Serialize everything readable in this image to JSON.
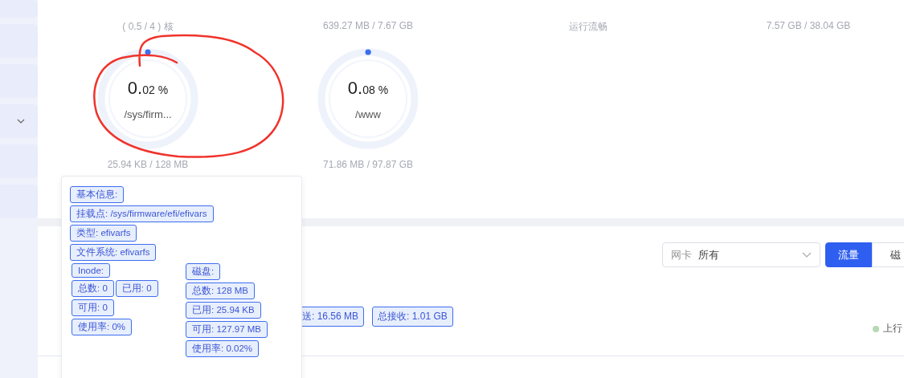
{
  "sidebar": {
    "items": [
      {
        "chevron": false
      },
      {
        "chevron": false
      },
      {
        "chevron": false
      },
      {
        "chevron": true
      },
      {
        "chevron": false
      },
      {
        "chevron": false
      }
    ]
  },
  "top_gauges": [
    {
      "label": "( 0.5 / 4 ) 核"
    },
    {
      "label": "639.27 MB / 7.67 GB"
    },
    {
      "label": "运行流畅"
    },
    {
      "label": "7.57 GB / 38.04 GB"
    }
  ],
  "disk_gauges": [
    {
      "value_main": "0.",
      "value_small": "02 %",
      "mount": "/sys/firm...",
      "level": 0.0002,
      "usage": "25.94 KB / 128 MB"
    },
    {
      "value_main": "0.",
      "value_small": "08 %",
      "mount": "/www",
      "level": 0.0008,
      "usage": "71.86 MB / 97.87 GB"
    }
  ],
  "network": {
    "select_label": "网卡",
    "select_value": "所有",
    "tabs": [
      {
        "label": "流量",
        "selected": true
      },
      {
        "label": "磁",
        "selected": false
      }
    ],
    "totals": [
      "送: 16.56 MB",
      "总接收: 1.01 GB"
    ],
    "legend": [
      {
        "label": "上行",
        "color": "#b5d9b0"
      }
    ]
  },
  "tooltip": {
    "basic": [
      "基本信息:",
      "挂载点: /sys/firmware/efi/efivars",
      "类型: efivarfs",
      "文件系统: efivarfs"
    ],
    "inode": [
      [
        "Inode:"
      ],
      [
        "总数: 0",
        "已用: 0"
      ],
      [
        "可用: 0"
      ],
      [
        "使用率: 0%"
      ]
    ],
    "disk": [
      [
        "磁盘:"
      ],
      [
        "总数: 128 MB"
      ],
      [
        "已用: 25.94 KB"
      ],
      [
        "可用: 127.97 MB"
      ],
      [
        "使用率: 0.02%"
      ]
    ]
  }
}
